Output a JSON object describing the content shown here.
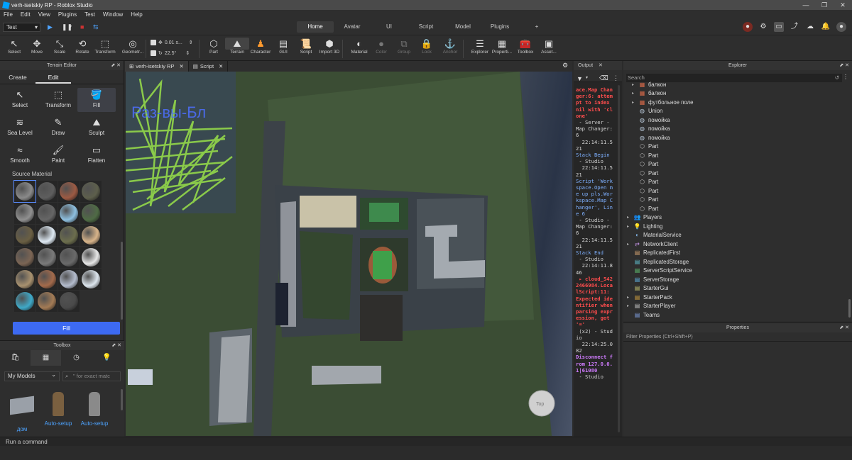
{
  "window": {
    "title": "verh-isetskiy RP - Roblox Studio"
  },
  "menu": [
    "File",
    "Edit",
    "View",
    "Plugins",
    "Test",
    "Window",
    "Help"
  ],
  "test_mode": "Test",
  "ribbon_tabs": [
    {
      "label": "Home",
      "active": true
    },
    {
      "label": "Avatar"
    },
    {
      "label": "UI"
    },
    {
      "label": "Script"
    },
    {
      "label": "Model"
    },
    {
      "label": "Plugins"
    },
    {
      "label": "+"
    }
  ],
  "tools": [
    {
      "label": "Select",
      "icon": "cursor-icon"
    },
    {
      "label": "Move",
      "icon": "move-icon"
    },
    {
      "label": "Scale",
      "icon": "scale-icon"
    },
    {
      "label": "Rotate",
      "icon": "rotate-icon"
    },
    {
      "label": "Transform",
      "icon": "transform-icon"
    },
    {
      "label": "Geometr...",
      "icon": "geometry-icon"
    },
    {
      "label": "Part",
      "icon": "part-icon"
    },
    {
      "label": "Terrain",
      "icon": "terrain-icon"
    },
    {
      "label": "Character",
      "icon": "character-icon"
    },
    {
      "label": "GUI",
      "icon": "gui-icon"
    },
    {
      "label": "Script",
      "icon": "script-icon"
    },
    {
      "label": "Import 3D",
      "icon": "import-icon"
    },
    {
      "label": "Material",
      "icon": "material-icon"
    },
    {
      "label": "Color",
      "icon": "color-icon"
    },
    {
      "label": "Group",
      "icon": "group-icon"
    },
    {
      "label": "Lock",
      "icon": "lock-icon"
    },
    {
      "label": "Anchor",
      "icon": "anchor-icon"
    },
    {
      "label": "Explorer",
      "icon": "explorer-icon"
    },
    {
      "label": "Properti...",
      "icon": "properties-icon"
    },
    {
      "label": "Toolbox",
      "icon": "toolbox-icon"
    },
    {
      "label": "Asset...",
      "icon": "asset-icon"
    }
  ],
  "snap": {
    "move": "0.01 s...",
    "rotate": "22.5°"
  },
  "terrain_editor": {
    "title": "Terrain Editor",
    "tabs": [
      {
        "label": "Create"
      },
      {
        "label": "Edit",
        "active": true
      }
    ],
    "tools": [
      {
        "label": "Select"
      },
      {
        "label": "Transform"
      },
      {
        "label": "Fill",
        "active": true
      },
      {
        "label": "Sea Level"
      },
      {
        "label": "Draw"
      },
      {
        "label": "Sculpt"
      },
      {
        "label": "Smooth"
      },
      {
        "label": "Paint"
      },
      {
        "label": "Flatten"
      }
    ],
    "source_material_label": "Source Material",
    "materials": [
      "#8a8a8a",
      "#5e5e5e",
      "#9c5a43",
      "#5d5f4c",
      "#909090",
      "#666666",
      "#8ec0e0",
      "#4f6b45",
      "#6a5f43",
      "#dfeaf4",
      "#6c6e4d",
      "#d8b48a",
      "#7b6554",
      "#7a7a7a",
      "#6a6a6a",
      "#e7e7e7",
      "#a8916f",
      "#a36a4b",
      "#b4bccd",
      "#dde6ee",
      "#3fa9c8",
      "#a37b55",
      "#4a4a4a"
    ],
    "fill_button": "Fill"
  },
  "toolbox": {
    "title": "Toolbox",
    "category": "My Models",
    "search_placeholder": "\" for exact matc",
    "items": [
      {
        "label": "дом"
      },
      {
        "label": "Auto-setup"
      },
      {
        "label": "Auto-setup"
      }
    ]
  },
  "doc_tabs": [
    {
      "label": "verh-isetskiy RP",
      "active": true
    },
    {
      "label": "Script"
    }
  ],
  "viewport": {
    "scribble_text": "Раз-вы-Бл",
    "view_cube": "Top"
  },
  "output": {
    "title": "Output",
    "lines": [
      {
        "t": "ace.Map Changer:6: attempt to index nil with 'clone'",
        "c": "err"
      },
      {
        "t": " - Server - Map Changer:6",
        "c": "norm"
      },
      {
        "t": "  22:14:11.521",
        "c": "norm"
      },
      {
        "t": "Stack Begin",
        "c": "info"
      },
      {
        "t": " - Studio",
        "c": "norm"
      },
      {
        "t": "  22:14:11.521",
        "c": "norm"
      },
      {
        "t": "Script 'Workspace.Open me up pls.Workspace.Map Changer', Line 6",
        "c": "info"
      },
      {
        "t": " - Studio - Map Changer:6",
        "c": "norm"
      },
      {
        "t": "  22:14:11.521",
        "c": "norm"
      },
      {
        "t": "Stack End",
        "c": "info"
      },
      {
        "t": " - Studio",
        "c": "norm"
      },
      {
        "t": "  22:14:11.846",
        "c": "norm"
      },
      {
        "t": " ▸ cloud_5422466984.LocalScript:11: Expected identifier when parsing expression, got '='",
        "c": "err"
      },
      {
        "t": " (x2) - Studio",
        "c": "norm"
      },
      {
        "t": "  22:14:25.082",
        "c": "norm"
      },
      {
        "t": "Disconnect from 127.0.0.1|61080",
        "c": "purple"
      },
      {
        "t": " - Studio",
        "c": "norm"
      }
    ]
  },
  "explorer": {
    "title": "Explorer",
    "search_placeholder": "Search",
    "nodes": [
      {
        "label": "балкон",
        "icon": "model-icon",
        "indent": 2,
        "arrow": "▸"
      },
      {
        "label": "балкон",
        "icon": "model-icon",
        "indent": 2,
        "arrow": "▸"
      },
      {
        "label": "футбольное поле",
        "icon": "model-icon",
        "indent": 2,
        "arrow": "▸"
      },
      {
        "label": "Union",
        "icon": "union-icon",
        "indent": 2,
        "arrow": ""
      },
      {
        "label": "помойка",
        "icon": "union-icon",
        "indent": 2,
        "arrow": ""
      },
      {
        "label": "помойка",
        "icon": "union-icon",
        "indent": 2,
        "arrow": ""
      },
      {
        "label": "помойка",
        "icon": "union-icon",
        "indent": 2,
        "arrow": ""
      },
      {
        "label": "Part",
        "icon": "part-icon",
        "indent": 2,
        "arrow": ""
      },
      {
        "label": "Part",
        "icon": "part-icon",
        "indent": 2,
        "arrow": ""
      },
      {
        "label": "Part",
        "icon": "part-icon",
        "indent": 2,
        "arrow": ""
      },
      {
        "label": "Part",
        "icon": "part-icon",
        "indent": 2,
        "arrow": ""
      },
      {
        "label": "Part",
        "icon": "part-icon",
        "indent": 2,
        "arrow": ""
      },
      {
        "label": "Part",
        "icon": "part-icon",
        "indent": 2,
        "arrow": ""
      },
      {
        "label": "Part",
        "icon": "part-icon",
        "indent": 2,
        "arrow": ""
      },
      {
        "label": "Part",
        "icon": "part-icon",
        "indent": 2,
        "arrow": ""
      },
      {
        "label": "Players",
        "icon": "players-icon",
        "indent": 1,
        "arrow": "▸"
      },
      {
        "label": "Lighting",
        "icon": "lighting-icon",
        "indent": 1,
        "arrow": "▸"
      },
      {
        "label": "MaterialService",
        "icon": "material-service-icon",
        "indent": 1,
        "arrow": ""
      },
      {
        "label": "NetworkClient",
        "icon": "network-icon",
        "indent": 1,
        "arrow": "▸"
      },
      {
        "label": "ReplicatedFirst",
        "icon": "replicated-first-icon",
        "indent": 1,
        "arrow": ""
      },
      {
        "label": "ReplicatedStorage",
        "icon": "replicated-storage-icon",
        "indent": 1,
        "arrow": ""
      },
      {
        "label": "ServerScriptService",
        "icon": "server-script-icon",
        "indent": 1,
        "arrow": ""
      },
      {
        "label": "ServerStorage",
        "icon": "server-storage-icon",
        "indent": 1,
        "arrow": ""
      },
      {
        "label": "StarterGui",
        "icon": "starter-gui-icon",
        "indent": 1,
        "arrow": ""
      },
      {
        "label": "StarterPack",
        "icon": "starter-pack-icon",
        "indent": 1,
        "arrow": "▸"
      },
      {
        "label": "StarterPlayer",
        "icon": "starter-player-icon",
        "indent": 1,
        "arrow": "▸"
      },
      {
        "label": "Teams",
        "icon": "teams-icon",
        "indent": 1,
        "arrow": ""
      }
    ]
  },
  "properties": {
    "title": "Properties",
    "filter_placeholder": "Filter Properties (Ctrl+Shift+P)"
  },
  "command_bar": {
    "placeholder": "Run a command"
  }
}
